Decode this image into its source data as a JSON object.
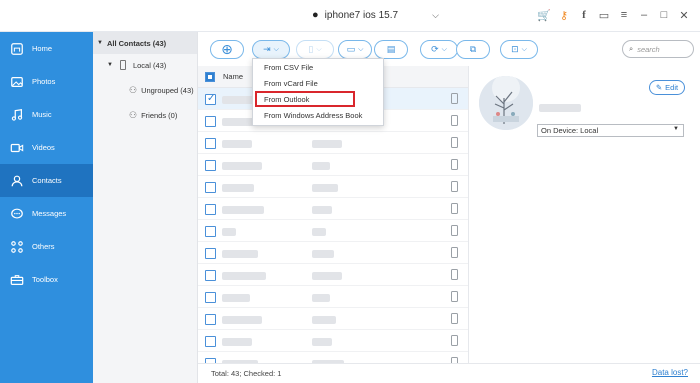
{
  "titlebar": {
    "device_name": "iphone7 ios 15.7",
    "icons": [
      "cart-icon",
      "key-icon",
      "facebook-icon",
      "feedback-icon",
      "menu-icon",
      "minimize-icon",
      "maximize-icon",
      "close-icon"
    ]
  },
  "sidebar": {
    "items": [
      {
        "label": "Home",
        "icon": "home-icon"
      },
      {
        "label": "Photos",
        "icon": "photos-icon"
      },
      {
        "label": "Music",
        "icon": "music-icon"
      },
      {
        "label": "Videos",
        "icon": "videos-icon"
      },
      {
        "label": "Contacts",
        "icon": "contacts-icon",
        "active": true
      },
      {
        "label": "Messages",
        "icon": "messages-icon"
      },
      {
        "label": "Others",
        "icon": "others-icon"
      },
      {
        "label": "Toolbox",
        "icon": "toolbox-icon"
      }
    ]
  },
  "tree": {
    "all": "All Contacts (43)",
    "local": "Local (43)",
    "ungrouped": "Ungrouped (43)",
    "friends": "Friends (0)"
  },
  "toolbar": {
    "search_placeholder": "search"
  },
  "import_menu": {
    "items": [
      "From CSV File",
      "From vCard File",
      "From Outlook",
      "From Windows Address Book"
    ],
    "highlighted": "From Outlook"
  },
  "list": {
    "header_name": "Name",
    "selected_row": 0,
    "row_count": 13
  },
  "detail": {
    "edit_label": "Edit",
    "device_select": "On Device: Local"
  },
  "status": {
    "summary": "Total: 43; Checked: 1",
    "data_lost_link": "Data lost?"
  },
  "colors": {
    "sidebar": "#2f8fde",
    "sidebar_active": "#1f73c0",
    "accent": "#2f80d0",
    "highlight_border": "#d9262c"
  }
}
